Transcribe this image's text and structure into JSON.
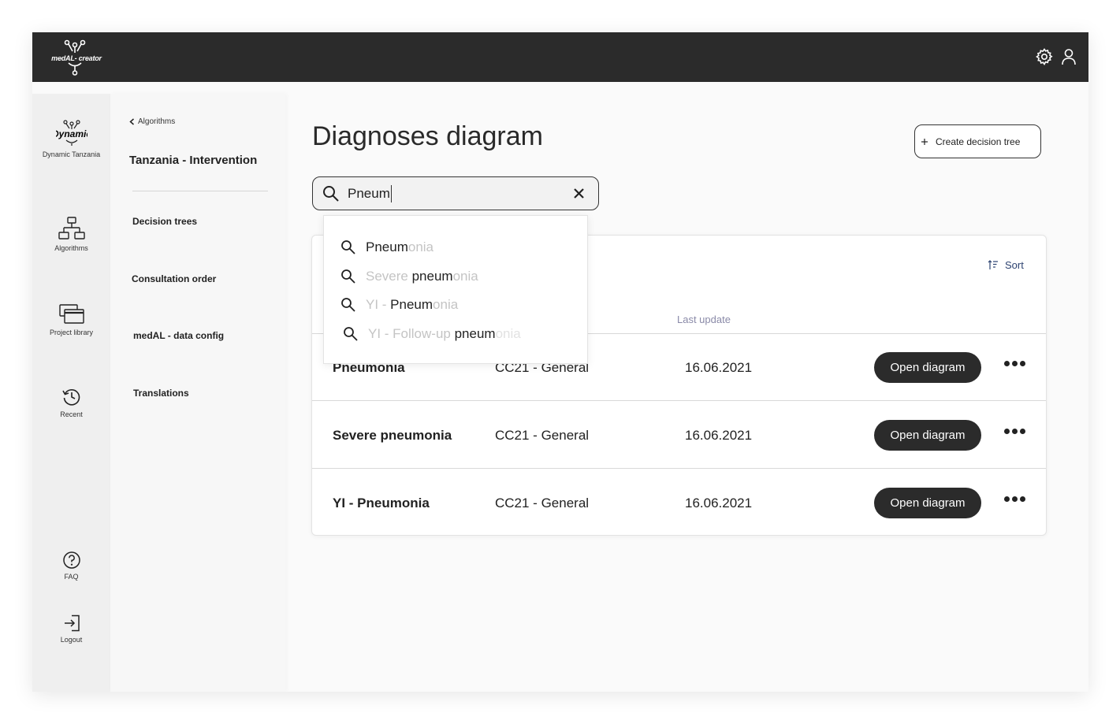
{
  "topbar": {
    "logo_text": "medAL- creator",
    "icons": [
      "gear-icon",
      "user-icon"
    ]
  },
  "iconbar": {
    "project_badge": "Dynamic",
    "project_label": "Dynamic Tanzania",
    "items": [
      {
        "icon": "hierarchy-icon",
        "label": "Algorithms"
      },
      {
        "icon": "library-icon",
        "label": "Project library"
      },
      {
        "icon": "history-icon",
        "label": "Recent"
      },
      {
        "icon": "help-icon",
        "label": "FAQ"
      },
      {
        "icon": "logout-icon",
        "label": "Logout"
      }
    ]
  },
  "subnav": {
    "back_label": "Algorithms",
    "project_title": "Tanzania - Intervention",
    "items": [
      "Decision trees",
      "Consultation order",
      "medAL - data config",
      "Translations"
    ]
  },
  "main": {
    "title": "Diagnoses diagram",
    "create_button": "Create decision tree",
    "search": {
      "value": "Pneum",
      "suggestions": [
        {
          "pre": "",
          "match": "Pneum",
          "post": "onia"
        },
        {
          "pre": "Severe ",
          "match": "pneum",
          "post": "onia"
        },
        {
          "pre": "YI - ",
          "match": "Pneum",
          "post": "onia"
        },
        {
          "pre": "YI - Follow-up ",
          "match": "pneum",
          "post": "onia"
        }
      ]
    },
    "table": {
      "sort_label": "Sort",
      "column_header": "Last update",
      "open_label": "Open diagram",
      "rows": [
        {
          "name": "Pneumonia",
          "category": "CC21 - General",
          "date": "16.06.2021"
        },
        {
          "name": "Severe pneumonia",
          "category": "CC21 - General",
          "date": "16.06.2021"
        },
        {
          "name": "YI - Pneumonia",
          "category": "CC21 - General",
          "date": "16.06.2021"
        }
      ]
    }
  },
  "colors": {
    "topbar": "#2b2b2b",
    "sort_accent": "#2c4270",
    "header_muted": "#8a8aa8"
  }
}
